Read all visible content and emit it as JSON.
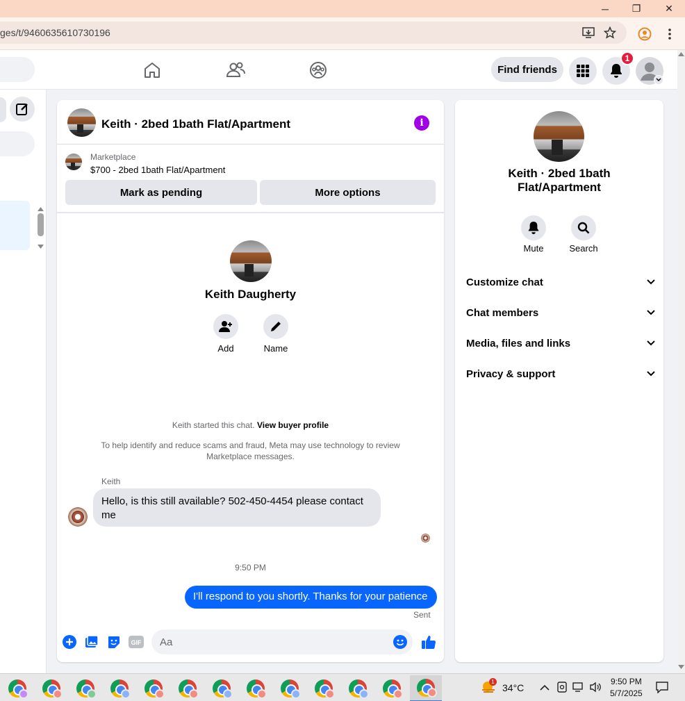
{
  "window": {
    "minimize": "─",
    "restore": "❐",
    "close": "✕"
  },
  "browser": {
    "url": "ges/t/9460635610730196"
  },
  "nav": {
    "find_friends": "Find friends",
    "notification_count": "1"
  },
  "chat": {
    "title": "Keith · 2bed 1bath Flat/Apartment",
    "marketplace_label": "Marketplace",
    "listing": "$700 - 2bed 1bath Flat/Apartment",
    "mark_pending": "Mark as pending",
    "more_options": "More options",
    "profile_name": "Keith Daugherty",
    "add_label": "Add",
    "name_label": "Name",
    "started_text": "Keith started this chat.",
    "view_buyer_profile": "View buyer profile",
    "scam_notice": "To help identify and reduce scams and fraud, Meta may use technology to review Marketplace messages.",
    "sender_name": "Keith",
    "incoming_message": "Hello, is this still available? 502-450-4454 please contact me",
    "timestamp": "9:50 PM",
    "outgoing_message": "I'll respond to you shortly. Thanks for your patience",
    "status": "Sent",
    "input_placeholder": "Aa"
  },
  "info_panel": {
    "title": "Keith · 2bed 1bath Flat/Apartment",
    "mute": "Mute",
    "search": "Search",
    "sections": [
      "Customize chat",
      "Chat members",
      "Media, files and links",
      "Privacy & support"
    ]
  },
  "taskbar": {
    "temperature": "34°C",
    "time": "9:50 PM",
    "date": "5/7/2025",
    "weather_badge": "1"
  },
  "colors": {
    "accent": "#0866ff",
    "info_purple": "#a100e6",
    "badge_red": "#e41e3f",
    "titlebar": "#fbd7c5"
  }
}
